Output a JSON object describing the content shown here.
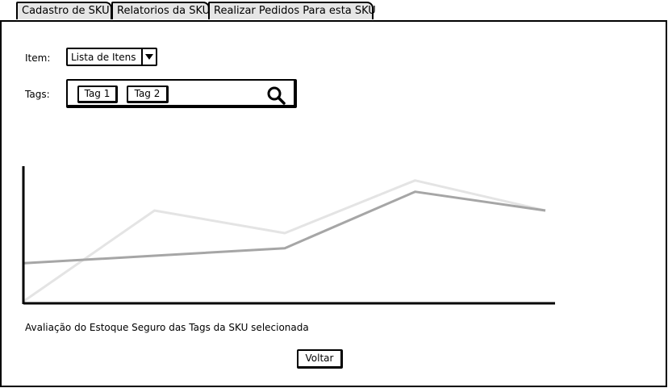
{
  "tabs": [
    {
      "label": "Cadastro de SKU",
      "active": true
    },
    {
      "label": "Relatorios da SKU",
      "active": false
    },
    {
      "label": "Realizar Pedidos Para esta SKU",
      "active": false
    }
  ],
  "form": {
    "item_label": "Item:",
    "item_value": "Lista de Itens",
    "tags_label": "Tags:",
    "tags": [
      "Tag 1",
      "Tag 2"
    ]
  },
  "chart_data": {
    "type": "line",
    "x": [
      0,
      1,
      2,
      3,
      4
    ],
    "series": [
      {
        "values": [
          0,
          48,
          36,
          64,
          48
        ],
        "color": "#e4e4e4"
      },
      {
        "values": [
          20,
          24,
          28,
          58,
          48
        ],
        "color": "#a6a6a6"
      }
    ],
    "ylim": [
      0,
      72
    ],
    "grid": false
  },
  "caption": "Avaliação do Estoque Seguro das Tags da SKU selecionada",
  "button_label": "Voltar",
  "icons": {
    "dropdown": "chevron-down-icon",
    "search": "search-icon"
  }
}
